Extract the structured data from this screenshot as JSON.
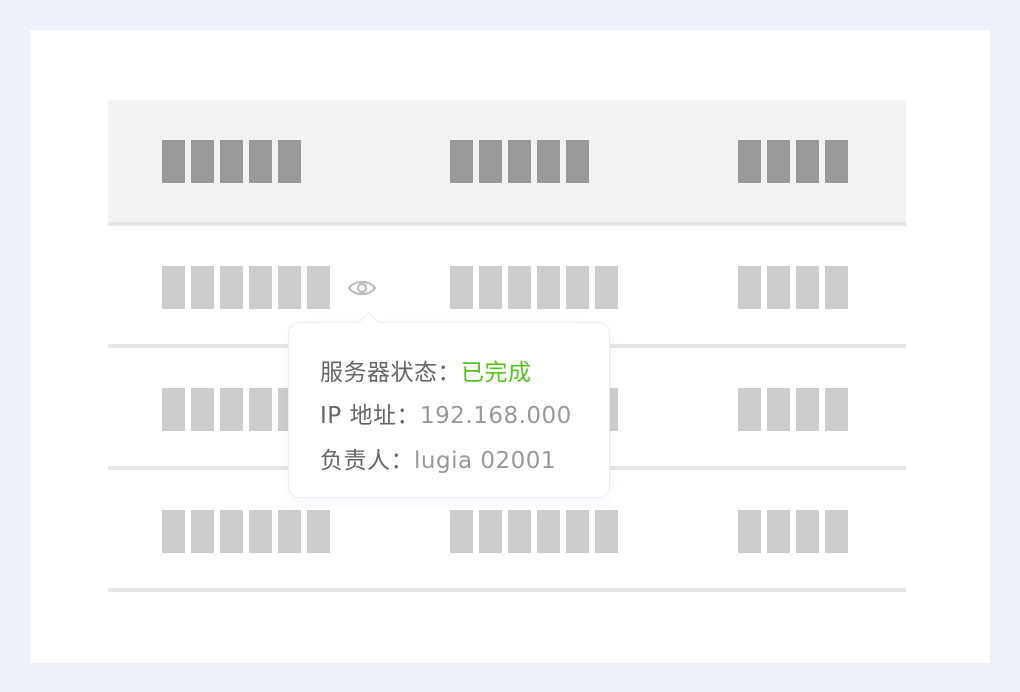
{
  "table": {
    "header_cols": [
      5,
      5,
      4
    ],
    "rows": [
      {
        "cols": [
          6,
          6,
          4
        ],
        "has_eye": true
      },
      {
        "cols": [
          6,
          6,
          4
        ],
        "has_eye": false
      },
      {
        "cols": [
          6,
          6,
          4
        ],
        "has_eye": false
      }
    ]
  },
  "icons": {
    "eye": "eye-icon"
  },
  "popover": {
    "status_label": "服务器状态：",
    "status_value": "已完成",
    "ip_label": "IP 地址：",
    "ip_value": "192.168.000",
    "owner_label": "负责人：",
    "owner_value": "lugia 02001"
  },
  "colors": {
    "status_success": "#52c41a",
    "header_block": "#999999",
    "row_block": "#cccccc"
  }
}
